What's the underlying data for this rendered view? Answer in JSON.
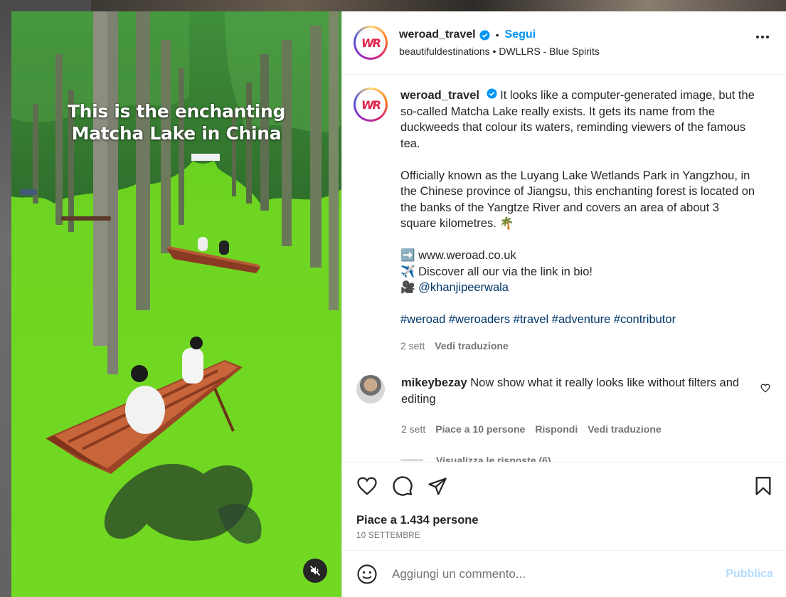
{
  "media": {
    "overlay_line1": "This is the enchanting",
    "overlay_line2": "Matcha Lake in China",
    "mute_icon": "speaker-muted-icon"
  },
  "header": {
    "avatar_initials": "WR",
    "username": "weroad_travel",
    "separator": "•",
    "follow_label": "Segui",
    "subtitle": "beautifuldestinations • DWLLRS - Blue Spirits",
    "more_icon": "more-options-icon"
  },
  "caption": {
    "username": "weroad_travel",
    "p1": "It looks like a computer-generated image, but the so-called Matcha Lake really exists. It gets its name from the duckweeds that colour its waters, reminding viewers of the famous tea.",
    "p2": "Officially known as the Luyang Lake Wetlands Park in Yangzhou, in the Chinese province of Jiangsu, this enchanting forest is located on the banks of the Yangtze River and covers an area of about 3 square kilometres. 🌴",
    "link_line": "➡️ www.weroad.co.uk",
    "discover_line": "✈️ Discover all our via the link in bio!",
    "camera_emoji": "🎥",
    "credit": "@khanjipeerwala",
    "hashtags": "#weroad #weroaders #travel #adventure #contributor",
    "time": "2 sett",
    "translate": "Vedi traduzione"
  },
  "comment": {
    "username": "mikeybezay",
    "text": "Now show what it really looks like without filters and editing",
    "time": "2 sett",
    "likes": "Piace a 10 persone",
    "reply": "Rispondi",
    "translate": "Vedi traduzione",
    "view_replies": "Visualizza le risposte (6)"
  },
  "actions": {
    "likes_text": "Piace a 1.434 persone",
    "date": "10 SETTEMBRE"
  },
  "add_comment": {
    "placeholder": "Aggiungi un commento...",
    "publish_label": "Pubblica"
  },
  "colors": {
    "accent_blue": "#0095f6",
    "link_blue": "#00376b",
    "muted_text": "#737373",
    "lake_green": "#6bd61f"
  }
}
